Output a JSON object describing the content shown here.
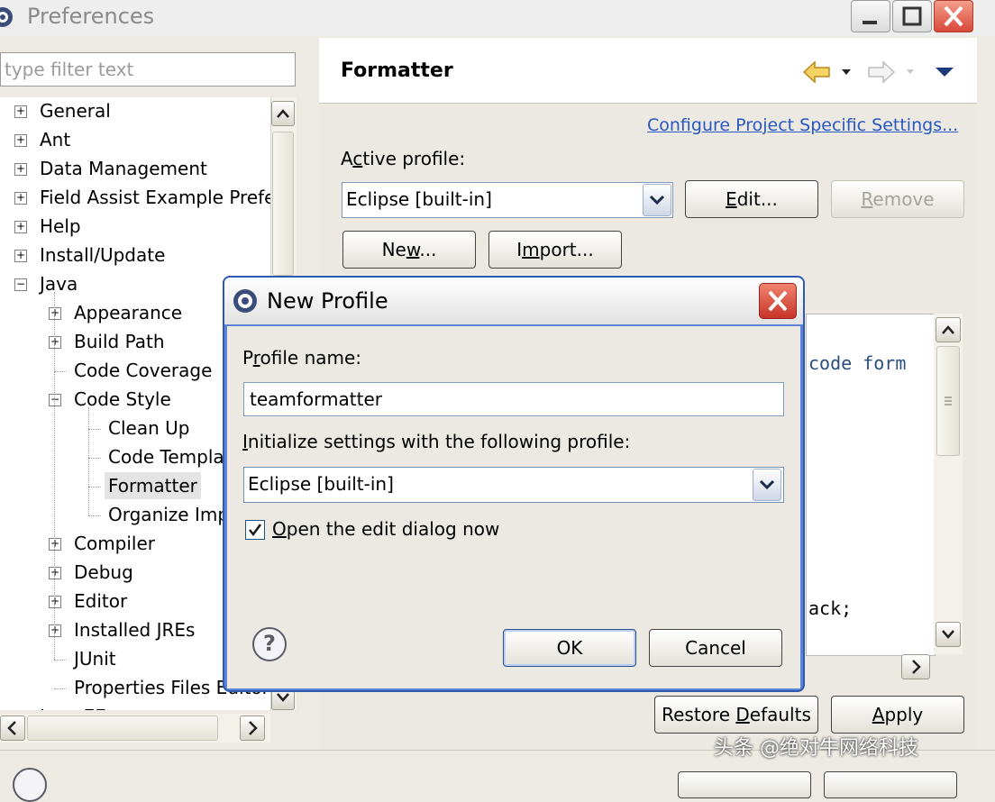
{
  "window": {
    "title": "Preferences",
    "minimize_icon": "minimize-icon",
    "maximize_icon": "maximize-icon",
    "close_icon": "close-icon"
  },
  "left": {
    "filter_placeholder": "type filter text",
    "tree": [
      {
        "label": "General",
        "level": 0,
        "expander": "plus"
      },
      {
        "label": "Ant",
        "level": 0,
        "expander": "plus"
      },
      {
        "label": "Data Management",
        "level": 0,
        "expander": "plus"
      },
      {
        "label": "Field Assist Example Prefe",
        "level": 0,
        "expander": "plus"
      },
      {
        "label": "Help",
        "level": 0,
        "expander": "plus"
      },
      {
        "label": "Install/Update",
        "level": 0,
        "expander": "plus"
      },
      {
        "label": "Java",
        "level": 0,
        "expander": "minus"
      },
      {
        "label": "Appearance",
        "level": 1,
        "expander": "plus"
      },
      {
        "label": "Build Path",
        "level": 1,
        "expander": "plus"
      },
      {
        "label": "Code Coverage",
        "level": 1,
        "expander": "none"
      },
      {
        "label": "Code Style",
        "level": 1,
        "expander": "minus"
      },
      {
        "label": "Clean Up",
        "level": 2,
        "expander": "none"
      },
      {
        "label": "Code Templa",
        "level": 2,
        "expander": "none"
      },
      {
        "label": "Formatter",
        "level": 2,
        "expander": "none",
        "selected": true
      },
      {
        "label": "Organize Imp",
        "level": 2,
        "expander": "none"
      },
      {
        "label": "Compiler",
        "level": 1,
        "expander": "plus"
      },
      {
        "label": "Debug",
        "level": 1,
        "expander": "plus"
      },
      {
        "label": "Editor",
        "level": 1,
        "expander": "plus"
      },
      {
        "label": "Installed JREs",
        "level": 1,
        "expander": "plus"
      },
      {
        "label": "JUnit",
        "level": 1,
        "expander": "none"
      },
      {
        "label": "Properties Files Editor",
        "level": 1,
        "expander": "none"
      },
      {
        "label": "Java EE",
        "level": 0,
        "expander": "plus"
      }
    ]
  },
  "right": {
    "title": "Formatter",
    "configure_link": "Configure Project Specific Settings...",
    "active_profile_label": "Active profile:",
    "active_profile_value": "Eclipse [built-in]",
    "edit_button": "Edit...",
    "remove_button": "Remove",
    "new_button": "New...",
    "import_button": "Import...",
    "preview_lines": [
      "code form",
      "ack;"
    ],
    "restore_button": "Restore Defaults",
    "apply_button": "Apply"
  },
  "dialog": {
    "title": "New Profile",
    "profile_name_label": "Profile name:",
    "profile_name_value": "teamformatter",
    "init_label": "Initialize settings with the following profile:",
    "init_value": "Eclipse [built-in]",
    "open_edit_label": "Open the edit dialog now",
    "open_edit_checked": true,
    "ok_button": "OK",
    "cancel_button": "Cancel",
    "help_glyph": "?"
  },
  "watermark": "头条 @绝对牛网络科技"
}
